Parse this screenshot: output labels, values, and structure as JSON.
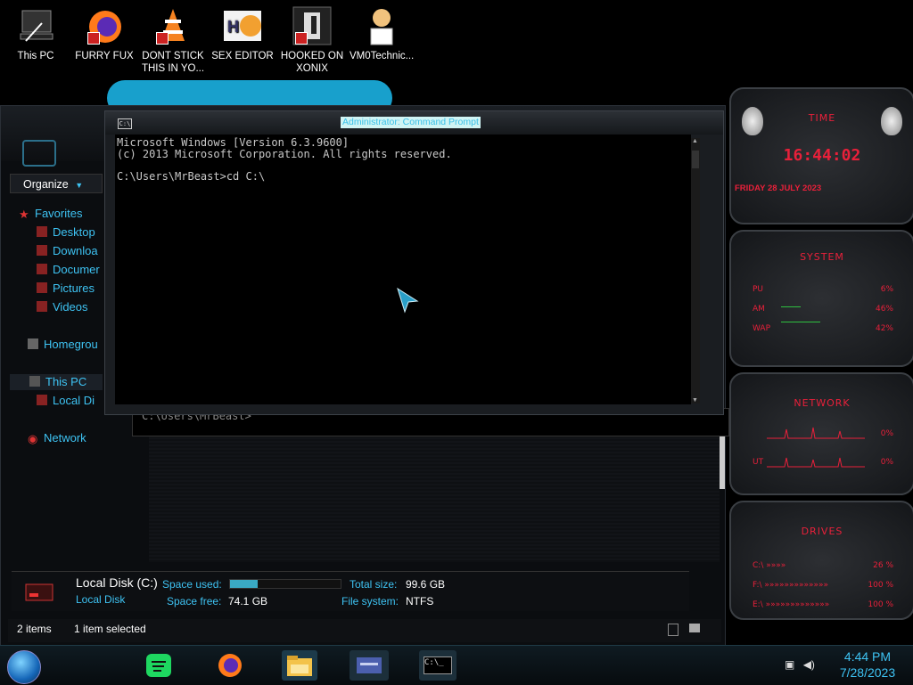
{
  "desktop": {
    "icons": [
      {
        "label": "This PC"
      },
      {
        "label": "FURRY FUX"
      },
      {
        "label": "DONT STICK THIS IN YO..."
      },
      {
        "label": "SEX EDITOR"
      },
      {
        "label": "HOOKED ON XONIX"
      },
      {
        "label": "VM0Technic..."
      }
    ]
  },
  "explorer": {
    "organize_label": "Organize",
    "nav": {
      "favorites": "Favorites",
      "desktop": "Desktop",
      "downloads": "Downloa",
      "documents": "Documer",
      "pictures": "Pictures",
      "videos": "Videos",
      "homegroup": "Homegrou",
      "this_pc": "This PC",
      "local_disk": "Local Di",
      "network": "Network"
    },
    "details": {
      "title": "Local Disk (C:)",
      "subtitle": "Local Disk",
      "space_used_label": "Space used:",
      "space_used_fraction": 0.25,
      "space_free_label": "Space free:",
      "space_free_value": "74.1 GB",
      "total_size_label": "Total size:",
      "total_size_value": "99.6 GB",
      "file_system_label": "File system:",
      "file_system_value": "NTFS"
    },
    "status": {
      "items": "2 items",
      "selected": "1 item selected"
    }
  },
  "cmd": {
    "title": "Administrator: Command Prompt",
    "sys_icon": "C:\\",
    "lines": [
      "Microsoft Windows [Version 6.3.9600]",
      "(c) 2013 Microsoft Corporation. All rights reserved.",
      "",
      "C:\\Users\\MrBeast>cd C:\\"
    ],
    "background_prompt": "C:\\Users\\MrBeast>"
  },
  "gadgets": {
    "time": {
      "title": "TIME",
      "clock": "16:44:02",
      "date": "FRIDAY 28 JULY 2023"
    },
    "system": {
      "title": "SYSTEM",
      "rows": [
        {
          "label": "PU",
          "value": "6%"
        },
        {
          "label": "AM",
          "value": "46%"
        },
        {
          "label": "WAP",
          "value": "42%"
        }
      ]
    },
    "network": {
      "title": "NETWORK",
      "rows": [
        {
          "label": "",
          "value": "0%"
        },
        {
          "label": "UT",
          "value": "0%"
        }
      ]
    },
    "drives": {
      "title": "DRIVES",
      "rows": [
        {
          "label": "C:\\",
          "value": "26 %"
        },
        {
          "label": "F:\\",
          "value": "100 %"
        },
        {
          "label": "E:\\",
          "value": "100 %"
        }
      ]
    }
  },
  "taskbar": {
    "apps": [
      "spotify-app",
      "firefox-app",
      "file-explorer-app",
      "control-panel-app",
      "command-prompt-app"
    ],
    "cmd_app_label": "C:\\_",
    "clock_time": "4:44 PM",
    "clock_date": "7/28/2023"
  },
  "colors": {
    "accent_cyan": "#3ec3f3",
    "gadget_red": "#e8203a",
    "wallpaper_blue": "#1fa8d6"
  }
}
